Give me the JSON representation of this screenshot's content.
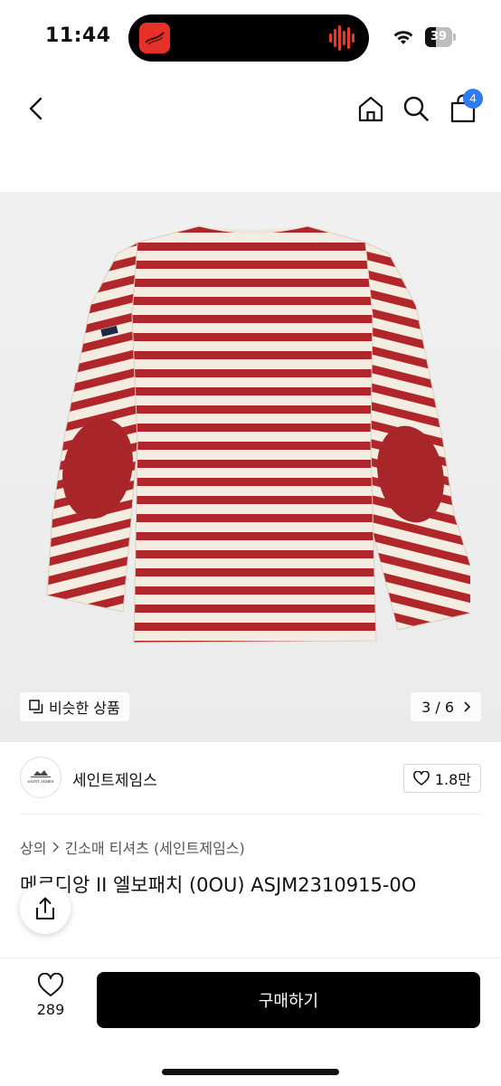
{
  "status_bar": {
    "time": "11:44",
    "battery": "39"
  },
  "nav": {
    "cart_badge": "4",
    "icons": [
      "back-icon",
      "home-icon",
      "search-icon",
      "cart-icon"
    ]
  },
  "gallery": {
    "similar_label": "비슷한 상품",
    "counter": "3 / 6",
    "colors": {
      "stripe": "#b0262a",
      "base": "#f3ede1",
      "patch": "#a8262a"
    }
  },
  "brand": {
    "name": "세인트제임스",
    "logo_text": "SAINT JAMES",
    "likes": "1.8만"
  },
  "product": {
    "breadcrumb": [
      "상의",
      "긴소매 티셔츠 (세인트제임스)"
    ],
    "title": "메르디앙 II 엘보패치 (0OU) ASJM2310915-0O"
  },
  "bottom_bar": {
    "wish_count": "289",
    "buy_label": "구매하기"
  },
  "colors": {
    "accent_badge": "#2f7bf5",
    "buy_button": "#000000"
  }
}
